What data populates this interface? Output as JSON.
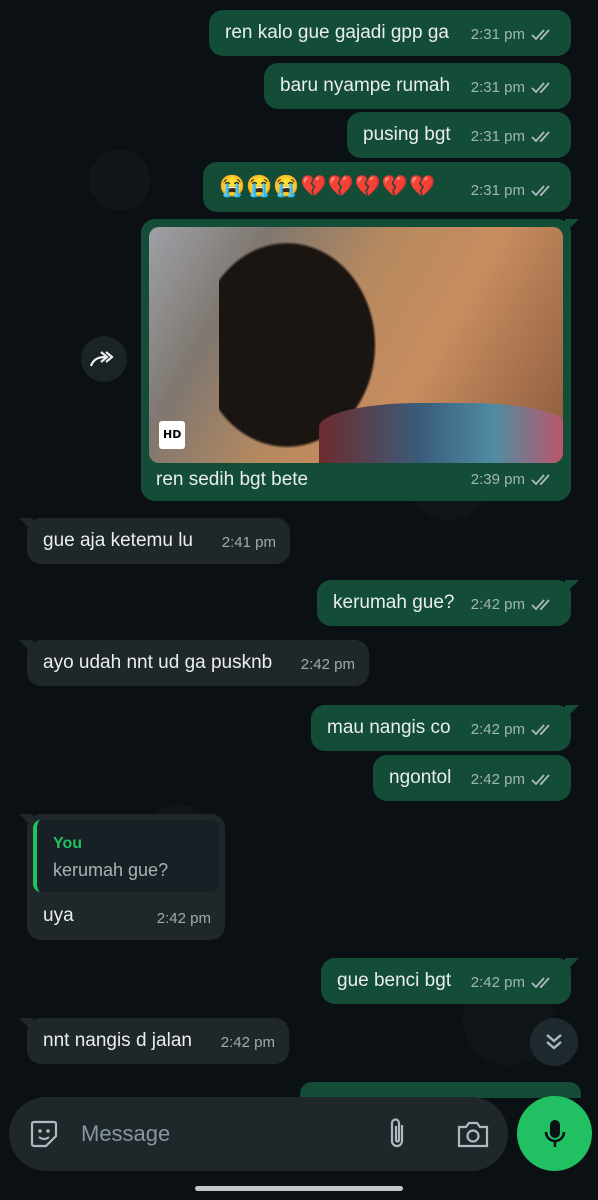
{
  "messages": [
    {
      "text": "ren kalo gue gajadi gpp ga",
      "time": "2:31 pm"
    },
    {
      "text": "baru nyampe rumah",
      "time": "2:31 pm"
    },
    {
      "text": "pusing bgt",
      "time": "2:31 pm"
    },
    {
      "text": "😭😭😭💔💔💔💔💔",
      "time": "2:31 pm"
    },
    {
      "caption": "ren sedih bgt bete",
      "time": "2:39 pm",
      "badge": "HD"
    },
    {
      "text": "gue aja ketemu lu",
      "time": "2:41 pm"
    },
    {
      "text": "kerumah gue?",
      "time": "2:42 pm"
    },
    {
      "text": "ayo udah nnt ud ga pusknb",
      "time": "2:42 pm"
    },
    {
      "text": "mau nangis co",
      "time": "2:42 pm"
    },
    {
      "text": "ngontol",
      "time": "2:42 pm"
    },
    {
      "quote_author": "You",
      "quote_text": "kerumah gue?",
      "text": "uya",
      "time": "2:42 pm"
    },
    {
      "text": "gue benci bgt",
      "time": "2:42 pm"
    },
    {
      "text": "nnt nangis d jalan",
      "time": "2:42 pm"
    }
  ],
  "composer": {
    "placeholder": "Message"
  },
  "icons": {
    "sticker": "sticker-icon",
    "attach": "paperclip-icon",
    "camera": "camera-icon",
    "mic": "microphone-icon",
    "forward": "forward-icon",
    "scroll": "double-chevron-down-icon"
  },
  "colors": {
    "outgoing": "#144d37",
    "incoming": "#1f272a",
    "accent": "#21c063",
    "background": "#0b1014"
  }
}
